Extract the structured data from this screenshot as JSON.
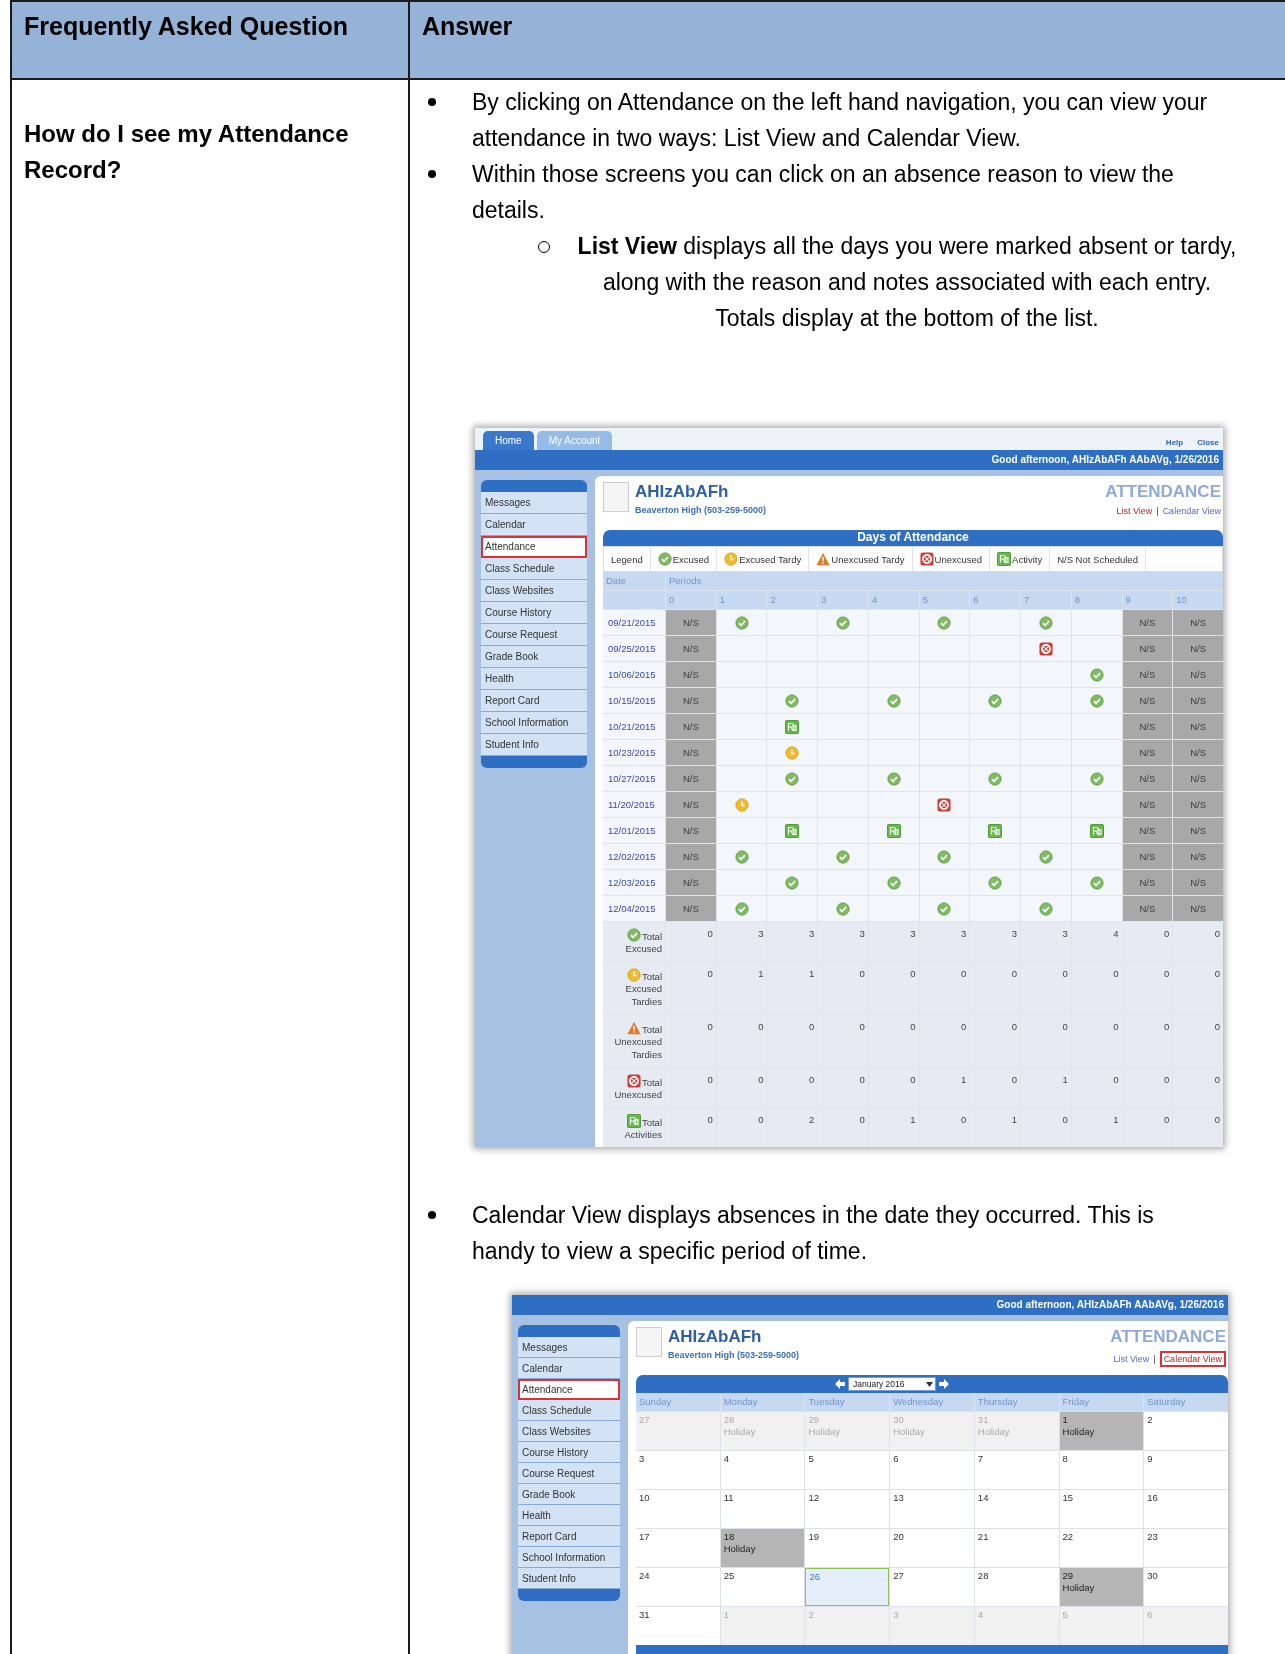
{
  "table": {
    "columns": [
      "Frequently Asked Question",
      "Answer"
    ]
  },
  "question": "How do I see my Attendance Record?",
  "answer": [
    {
      "kind": "bullet",
      "text": "By clicking on Attendance on the left hand navigation, you can view your attendance in two ways: List View and Calendar View."
    },
    {
      "kind": "bullet",
      "text": "Within those screens you can click on an absence reason to view the details."
    },
    {
      "kind": "sub_bullet",
      "text": "**List View** displays all the days you were marked absent or tardy, along with the reason and notes associated with each entry. Totals display at the bottom of the list."
    },
    {
      "kind": "list_screenshot",
      "tabs": [
        {
          "label": "Home",
          "selected": true
        },
        {
          "label": "My Account",
          "selected": false
        }
      ],
      "links": [
        "Help",
        "Close"
      ],
      "greeting": "Good afternoon, AHIzAbAFh AAbAVg, 1/26/2016",
      "nav": [
        {
          "label": "Messages",
          "selected": false
        },
        {
          "label": "Calendar",
          "selected": false
        },
        {
          "label": "Attendance",
          "selected": true
        },
        {
          "label": "Class Schedule",
          "selected": false
        },
        {
          "label": "Class Websites",
          "selected": false
        },
        {
          "label": "Course History",
          "selected": false
        },
        {
          "label": "Course Request",
          "selected": false
        },
        {
          "label": "Grade Book",
          "selected": false
        },
        {
          "label": "Health",
          "selected": false
        },
        {
          "label": "Report Card",
          "selected": false
        },
        {
          "label": "School Information",
          "selected": false
        },
        {
          "label": "Student Info",
          "selected": false
        }
      ],
      "student": "AHIzAbAFh",
      "school": "Beaverton High (503-259-5000)",
      "page_title": "ATTENDANCE",
      "views": [
        {
          "label": "List View",
          "selected": true,
          "outlined": false
        },
        {
          "label": "Calendar View",
          "selected": false,
          "outlined": false
        }
      ],
      "separator": "|",
      "section_title": "Days of Attendance",
      "legend_label": "Legend",
      "legend": [
        {
          "kind": "excused",
          "label": "Excused"
        },
        {
          "kind": "tardy",
          "label": "Excused Tardy"
        },
        {
          "kind": "unexcused_tardy",
          "label": "Unexcused Tardy"
        },
        {
          "kind": "unexcused",
          "label": "Unexcused"
        },
        {
          "kind": "activity",
          "label": "Activity"
        },
        {
          "kind": "ns",
          "label": "N/S Not Scheduled"
        }
      ],
      "date_header": "Date",
      "periods_header": "Periods",
      "periods": [
        "0",
        "1",
        "2",
        "3",
        "4",
        "5",
        "6",
        "7",
        "8",
        "9",
        "10"
      ],
      "rows": [
        {
          "date": "09/21/2015",
          "cells": [
            {
              "kind": "ns",
              "text": "N/S"
            },
            {
              "kind": "excused"
            },
            {
              "kind": "blank"
            },
            {
              "kind": "excused"
            },
            {
              "kind": "blank"
            },
            {
              "kind": "excused"
            },
            {
              "kind": "blank"
            },
            {
              "kind": "excused"
            },
            {
              "kind": "blank"
            },
            {
              "kind": "ns",
              "text": "N/S"
            },
            {
              "kind": "ns",
              "text": "N/S"
            }
          ]
        },
        {
          "date": "09/25/2015",
          "cells": [
            {
              "kind": "ns",
              "text": "N/S"
            },
            {
              "kind": "blank"
            },
            {
              "kind": "blank"
            },
            {
              "kind": "blank"
            },
            {
              "kind": "blank"
            },
            {
              "kind": "blank"
            },
            {
              "kind": "blank"
            },
            {
              "kind": "unexcused"
            },
            {
              "kind": "blank"
            },
            {
              "kind": "ns",
              "text": "N/S"
            },
            {
              "kind": "ns",
              "text": "N/S"
            }
          ]
        },
        {
          "date": "10/06/2015",
          "cells": [
            {
              "kind": "ns",
              "text": "N/S"
            },
            {
              "kind": "blank"
            },
            {
              "kind": "blank"
            },
            {
              "kind": "blank"
            },
            {
              "kind": "blank"
            },
            {
              "kind": "blank"
            },
            {
              "kind": "blank"
            },
            {
              "kind": "blank"
            },
            {
              "kind": "excused"
            },
            {
              "kind": "ns",
              "text": "N/S"
            },
            {
              "kind": "ns",
              "text": "N/S"
            }
          ]
        },
        {
          "date": "10/15/2015",
          "cells": [
            {
              "kind": "ns",
              "text": "N/S"
            },
            {
              "kind": "blank"
            },
            {
              "kind": "excused"
            },
            {
              "kind": "blank"
            },
            {
              "kind": "excused"
            },
            {
              "kind": "blank"
            },
            {
              "kind": "excused"
            },
            {
              "kind": "blank"
            },
            {
              "kind": "excused"
            },
            {
              "kind": "ns",
              "text": "N/S"
            },
            {
              "kind": "ns",
              "text": "N/S"
            }
          ]
        },
        {
          "date": "10/21/2015",
          "cells": [
            {
              "kind": "ns",
              "text": "N/S"
            },
            {
              "kind": "blank"
            },
            {
              "kind": "activity"
            },
            {
              "kind": "blank"
            },
            {
              "kind": "blank"
            },
            {
              "kind": "blank"
            },
            {
              "kind": "blank"
            },
            {
              "kind": "blank"
            },
            {
              "kind": "blank"
            },
            {
              "kind": "ns",
              "text": "N/S"
            },
            {
              "kind": "ns",
              "text": "N/S"
            }
          ]
        },
        {
          "date": "10/23/2015",
          "cells": [
            {
              "kind": "ns",
              "text": "N/S"
            },
            {
              "kind": "blank"
            },
            {
              "kind": "tardy"
            },
            {
              "kind": "blank"
            },
            {
              "kind": "blank"
            },
            {
              "kind": "blank"
            },
            {
              "kind": "blank"
            },
            {
              "kind": "blank"
            },
            {
              "kind": "blank"
            },
            {
              "kind": "ns",
              "text": "N/S"
            },
            {
              "kind": "ns",
              "text": "N/S"
            }
          ]
        },
        {
          "date": "10/27/2015",
          "cells": [
            {
              "kind": "ns",
              "text": "N/S"
            },
            {
              "kind": "blank"
            },
            {
              "kind": "excused"
            },
            {
              "kind": "blank"
            },
            {
              "kind": "excused"
            },
            {
              "kind": "blank"
            },
            {
              "kind": "excused"
            },
            {
              "kind": "blank"
            },
            {
              "kind": "excused"
            },
            {
              "kind": "ns",
              "text": "N/S"
            },
            {
              "kind": "ns",
              "text": "N/S"
            }
          ]
        },
        {
          "date": "11/20/2015",
          "cells": [
            {
              "kind": "ns",
              "text": "N/S"
            },
            {
              "kind": "tardy"
            },
            {
              "kind": "blank"
            },
            {
              "kind": "blank"
            },
            {
              "kind": "blank"
            },
            {
              "kind": "unexcused"
            },
            {
              "kind": "blank"
            },
            {
              "kind": "blank"
            },
            {
              "kind": "blank"
            },
            {
              "kind": "ns",
              "text": "N/S"
            },
            {
              "kind": "ns",
              "text": "N/S"
            }
          ]
        },
        {
          "date": "12/01/2015",
          "cells": [
            {
              "kind": "ns",
              "text": "N/S"
            },
            {
              "kind": "blank"
            },
            {
              "kind": "activity"
            },
            {
              "kind": "blank"
            },
            {
              "kind": "activity"
            },
            {
              "kind": "blank"
            },
            {
              "kind": "activity"
            },
            {
              "kind": "blank"
            },
            {
              "kind": "activity"
            },
            {
              "kind": "ns",
              "text": "N/S"
            },
            {
              "kind": "ns",
              "text": "N/S"
            }
          ]
        },
        {
          "date": "12/02/2015",
          "cells": [
            {
              "kind": "ns",
              "text": "N/S"
            },
            {
              "kind": "excused"
            },
            {
              "kind": "blank"
            },
            {
              "kind": "excused"
            },
            {
              "kind": "blank"
            },
            {
              "kind": "excused"
            },
            {
              "kind": "blank"
            },
            {
              "kind": "excused"
            },
            {
              "kind": "blank"
            },
            {
              "kind": "ns",
              "text": "N/S"
            },
            {
              "kind": "ns",
              "text": "N/S"
            }
          ]
        },
        {
          "date": "12/03/2015",
          "cells": [
            {
              "kind": "ns",
              "text": "N/S"
            },
            {
              "kind": "blank"
            },
            {
              "kind": "excused"
            },
            {
              "kind": "blank"
            },
            {
              "kind": "excused"
            },
            {
              "kind": "blank"
            },
            {
              "kind": "excused"
            },
            {
              "kind": "blank"
            },
            {
              "kind": "excused"
            },
            {
              "kind": "ns",
              "text": "N/S"
            },
            {
              "kind": "ns",
              "text": "N/S"
            }
          ]
        },
        {
          "date": "12/04/2015",
          "cells": [
            {
              "kind": "ns",
              "text": "N/S"
            },
            {
              "kind": "excused"
            },
            {
              "kind": "blank"
            },
            {
              "kind": "excused"
            },
            {
              "kind": "blank"
            },
            {
              "kind": "excused"
            },
            {
              "kind": "blank"
            },
            {
              "kind": "excused"
            },
            {
              "kind": "blank"
            },
            {
              "kind": "ns",
              "text": "N/S"
            },
            {
              "kind": "ns",
              "text": "N/S"
            }
          ]
        }
      ],
      "totals": [
        {
          "kind": "excused",
          "label": "Total",
          "sublabel": "Excused",
          "values": [
            "0",
            "3",
            "3",
            "3",
            "3",
            "3",
            "3",
            "3",
            "4",
            "0",
            "0"
          ]
        },
        {
          "kind": "tardy",
          "label": "Total",
          "sublabel": "Excused Tardies",
          "values": [
            "0",
            "1",
            "1",
            "0",
            "0",
            "0",
            "0",
            "0",
            "0",
            "0",
            "0"
          ]
        },
        {
          "kind": "unexcused_tardy",
          "label": "Total",
          "sublabel": "Unexcused Tardies",
          "values": [
            "0",
            "0",
            "0",
            "0",
            "0",
            "0",
            "0",
            "0",
            "0",
            "0",
            "0"
          ]
        },
        {
          "kind": "unexcused",
          "label": "Total",
          "sublabel": "Unexcused",
          "values": [
            "0",
            "0",
            "0",
            "0",
            "0",
            "1",
            "0",
            "1",
            "0",
            "0",
            "0"
          ]
        },
        {
          "kind": "activity",
          "label": "Total",
          "sublabel": "Activities",
          "values": [
            "0",
            "0",
            "2",
            "0",
            "1",
            "0",
            "1",
            "0",
            "1",
            "0",
            "0"
          ]
        }
      ]
    },
    {
      "kind": "bullet",
      "text": "Calendar View displays absences in the date they occurred. This is handy to view a specific period of time."
    },
    {
      "kind": "calendar_screenshot",
      "greeting": "Good afternoon, AHIzAbAFh AAbAVg, 1/26/2016",
      "nav": [
        {
          "label": "Messages",
          "selected": false
        },
        {
          "label": "Calendar",
          "selected": false
        },
        {
          "label": "Attendance",
          "selected": true
        },
        {
          "label": "Class Schedule",
          "selected": false
        },
        {
          "label": "Class Websites",
          "selected": false
        },
        {
          "label": "Course History",
          "selected": false
        },
        {
          "label": "Course Request",
          "selected": false
        },
        {
          "label": "Grade Book",
          "selected": false
        },
        {
          "label": "Health",
          "selected": false
        },
        {
          "label": "Report Card",
          "selected": false
        },
        {
          "label": "School Information",
          "selected": false
        },
        {
          "label": "Student Info",
          "selected": false
        }
      ],
      "student": "AHIzAbAFh",
      "school": "Beaverton High (503-259-5000)",
      "page_title": "ATTENDANCE",
      "views": [
        {
          "label": "List View",
          "selected": false,
          "outlined": false
        },
        {
          "label": "Calendar View",
          "selected": true,
          "outlined": true
        }
      ],
      "separator": "|",
      "month": "January 2016",
      "weekdays": [
        "Sunday",
        "Monday",
        "Tuesday",
        "Wednesday",
        "Thursday",
        "Friday",
        "Saturday"
      ],
      "weeks": [
        [
          {
            "day": "27",
            "kind": "outside"
          },
          {
            "day": "28",
            "kind": "outside",
            "note": "Holiday"
          },
          {
            "day": "29",
            "kind": "outside",
            "note": "Holiday"
          },
          {
            "day": "30",
            "kind": "outside",
            "note": "Holiday"
          },
          {
            "day": "31",
            "kind": "outside",
            "note": "Holiday"
          },
          {
            "day": "1",
            "kind": "holiday",
            "note": "Holiday"
          },
          {
            "day": "2",
            "kind": "day"
          }
        ],
        [
          {
            "day": "3",
            "kind": "day"
          },
          {
            "day": "4",
            "kind": "day"
          },
          {
            "day": "5",
            "kind": "day"
          },
          {
            "day": "6",
            "kind": "day"
          },
          {
            "day": "7",
            "kind": "day"
          },
          {
            "day": "8",
            "kind": "day"
          },
          {
            "day": "9",
            "kind": "day"
          }
        ],
        [
          {
            "day": "10",
            "kind": "day"
          },
          {
            "day": "11",
            "kind": "day"
          },
          {
            "day": "12",
            "kind": "day"
          },
          {
            "day": "13",
            "kind": "day"
          },
          {
            "day": "14",
            "kind": "day"
          },
          {
            "day": "15",
            "kind": "day"
          },
          {
            "day": "16",
            "kind": "day"
          }
        ],
        [
          {
            "day": "17",
            "kind": "day"
          },
          {
            "day": "18",
            "kind": "holiday",
            "note": "Holiday"
          },
          {
            "day": "19",
            "kind": "day"
          },
          {
            "day": "20",
            "kind": "day"
          },
          {
            "day": "21",
            "kind": "day"
          },
          {
            "day": "22",
            "kind": "day"
          },
          {
            "day": "23",
            "kind": "day"
          }
        ],
        [
          {
            "day": "24",
            "kind": "day"
          },
          {
            "day": "25",
            "kind": "day"
          },
          {
            "day": "26",
            "kind": "today"
          },
          {
            "day": "27",
            "kind": "day"
          },
          {
            "day": "28",
            "kind": "day"
          },
          {
            "day": "29",
            "kind": "holiday",
            "note": "Holiday"
          },
          {
            "day": "30",
            "kind": "day"
          }
        ],
        [
          {
            "day": "31",
            "kind": "day"
          },
          {
            "day": "1",
            "kind": "outside"
          },
          {
            "day": "2",
            "kind": "outside"
          },
          {
            "day": "3",
            "kind": "outside"
          },
          {
            "day": "4",
            "kind": "outside"
          },
          {
            "day": "5",
            "kind": "outside"
          },
          {
            "day": "6",
            "kind": "outside"
          }
        ]
      ]
    }
  ]
}
